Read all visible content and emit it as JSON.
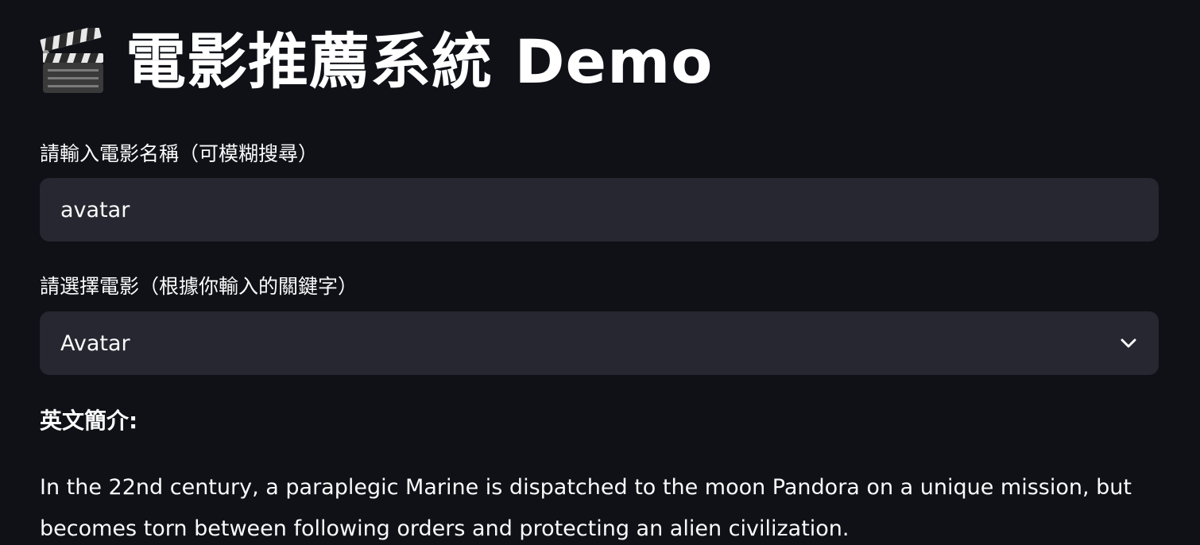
{
  "title": {
    "icon": "clapperboard-icon",
    "text": "電影推薦系統 Demo"
  },
  "search": {
    "label": "請輸入電影名稱（可模糊搜尋）",
    "value": "avatar",
    "placeholder": ""
  },
  "movie_select": {
    "label": "請選擇電影（根據你輸入的關鍵字）",
    "selected": "Avatar",
    "icon": "chevron-down-icon"
  },
  "overview": {
    "heading": "英文簡介:",
    "text": "In the 22nd century, a paraplegic Marine is dispatched to the moon Pandora on a unique mission, but becomes torn between following orders and protecting an alien civilization."
  },
  "colors": {
    "background": "#0f1117",
    "input_background": "#262730",
    "text": "#fafafa"
  }
}
